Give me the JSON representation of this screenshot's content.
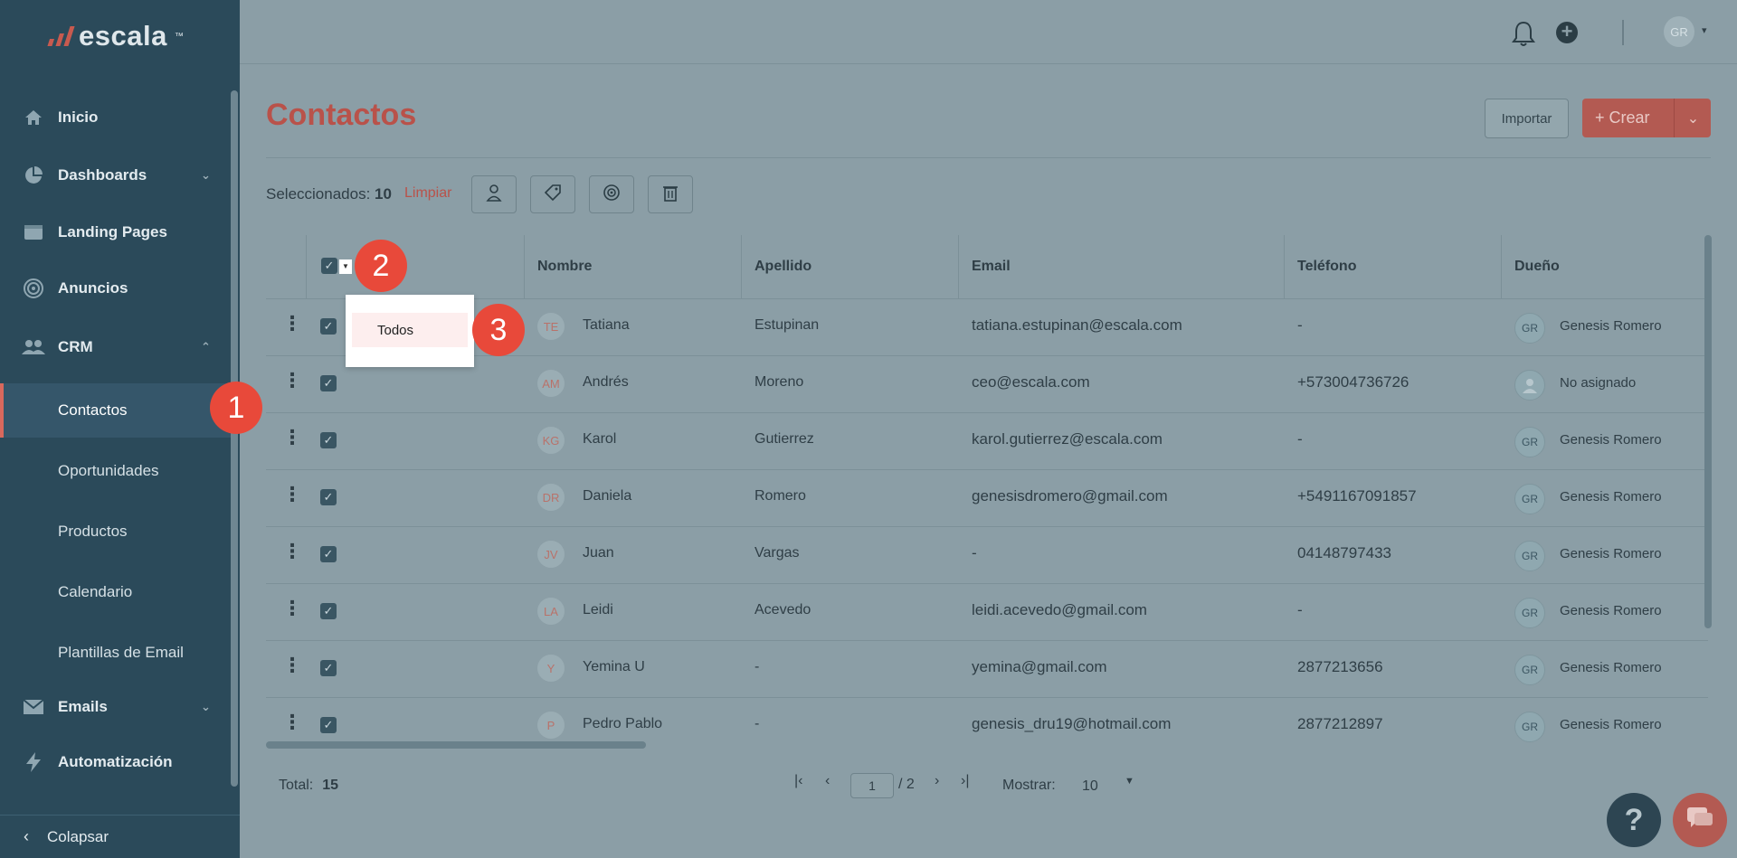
{
  "app": {
    "brand": "escala",
    "trademark": "™"
  },
  "sidebar": {
    "items": [
      {
        "label": "Inicio",
        "icon": "home-icon"
      },
      {
        "label": "Dashboards",
        "icon": "pie-chart-icon"
      },
      {
        "label": "Landing Pages",
        "icon": "browser-icon"
      },
      {
        "label": "Anuncios",
        "icon": "target-icon"
      },
      {
        "label": "CRM",
        "icon": "users-icon"
      }
    ],
    "crm_sub": [
      "Contactos",
      "Oportunidades",
      "Productos",
      "Calendario",
      "Plantillas de Email"
    ],
    "bottom_items": [
      {
        "label": "Emails",
        "icon": "mail-icon"
      },
      {
        "label": "Automatización",
        "icon": "bolt-icon"
      }
    ],
    "collapse_label": "Colapsar"
  },
  "header": {
    "avatar_initials": "GR"
  },
  "page": {
    "title": "Contactos",
    "import_label": "Importar",
    "create_label": "+ Crear"
  },
  "selection": {
    "label": "Seleccionados:",
    "count": "10",
    "clear_label": "Limpiar"
  },
  "table": {
    "columns": [
      "Nombre",
      "Apellido",
      "Email",
      "Teléfono",
      "Dueño"
    ],
    "rows": [
      {
        "initials": "TE",
        "name": "Tatiana",
        "last": "Estupinan",
        "email": "tatiana.estupinan@escala.com",
        "phone": "-",
        "owner_initials": "GR",
        "owner": "Genesis Romero"
      },
      {
        "initials": "AM",
        "name": "Andrés",
        "last": "Moreno",
        "email": "ceo@escala.com",
        "phone": "+573004736726",
        "owner_initials": "",
        "owner": "No asignado"
      },
      {
        "initials": "KG",
        "name": "Karol",
        "last": "Gutierrez",
        "email": "karol.gutierrez@escala.com",
        "phone": "-",
        "owner_initials": "GR",
        "owner": "Genesis Romero"
      },
      {
        "initials": "DR",
        "name": "Daniela",
        "last": "Romero",
        "email": "genesisdromero@gmail.com",
        "phone": "+5491167091857",
        "owner_initials": "GR",
        "owner": "Genesis Romero"
      },
      {
        "initials": "JV",
        "name": "Juan",
        "last": "Vargas",
        "email": "-",
        "phone": "04148797433",
        "owner_initials": "GR",
        "owner": "Genesis Romero"
      },
      {
        "initials": "LA",
        "name": "Leidi",
        "last": "Acevedo",
        "email": "leidi.acevedo@gmail.com",
        "phone": "-",
        "owner_initials": "GR",
        "owner": "Genesis Romero"
      },
      {
        "initials": "Y",
        "name": "Yemina U",
        "last": "-",
        "email": "yemina@gmail.com",
        "phone": "2877213656",
        "owner_initials": "GR",
        "owner": "Genesis Romero"
      },
      {
        "initials": "P",
        "name": "Pedro Pablo",
        "last": "-",
        "email": "genesis_dru19@hotmail.com",
        "phone": "2877212897",
        "owner_initials": "GR",
        "owner": "Genesis Romero"
      }
    ]
  },
  "dropdown": {
    "option": "Todos"
  },
  "footer": {
    "total_label": "Total:",
    "total": "15",
    "page": "1",
    "page_of": "/ 2",
    "show_label": "Mostrar:",
    "show_value": "10"
  },
  "help_label": "?",
  "steps": [
    "1",
    "2",
    "3"
  ],
  "colors": {
    "accent": "#b9524a",
    "sidebar": "#2b4a5a",
    "step": "#e8493a"
  }
}
